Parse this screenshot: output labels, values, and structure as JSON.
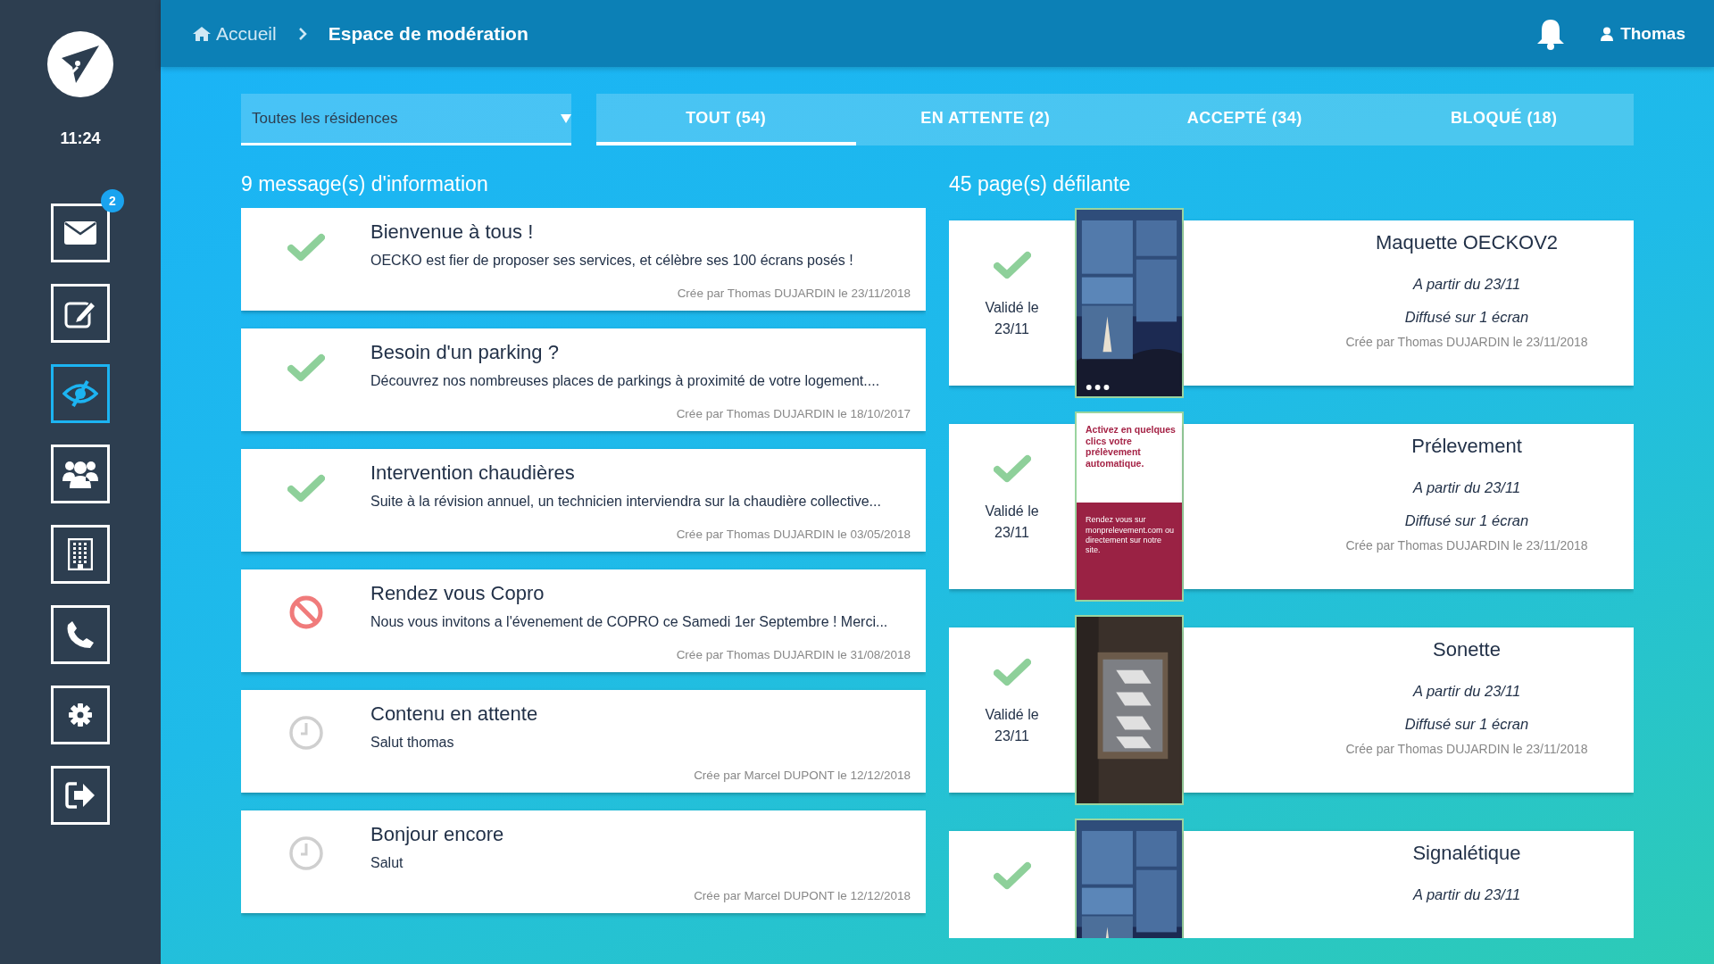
{
  "sidebar": {
    "time": "11:24",
    "items": [
      {
        "kind": "mail",
        "selected": false,
        "badge": "2"
      },
      {
        "kind": "edit",
        "selected": false
      },
      {
        "kind": "moderation",
        "selected": true
      },
      {
        "kind": "users",
        "selected": false
      },
      {
        "kind": "building",
        "selected": false
      },
      {
        "kind": "phone",
        "selected": false
      },
      {
        "kind": "settings",
        "selected": false
      },
      {
        "kind": "logout",
        "selected": false
      }
    ]
  },
  "breadcrumb": [
    {
      "label": "Accueil"
    },
    {
      "label": "Espace de modération"
    }
  ],
  "user": {
    "name": "Thomas"
  },
  "filter": {
    "value": "Toutes les résidences"
  },
  "tabs": [
    {
      "label": "TOUT (54)",
      "selected": true
    },
    {
      "label": "EN ATTENTE (2)",
      "selected": false
    },
    {
      "label": "ACCEPTÉ (34)",
      "selected": false
    },
    {
      "label": "BLOQUÉ (18)",
      "selected": false
    }
  ],
  "messages": {
    "heading": "9 message(s) d'information",
    "items": [
      {
        "kind": "accepted",
        "title": "Bienvenue à tous !",
        "body": "OECKO est fier de proposer ses services, et célèbre ses 100 écrans posés !",
        "meta": "Crée par Thomas DUJARDIN le 23/11/2018"
      },
      {
        "kind": "accepted",
        "title": "Besoin d'un parking ?",
        "body": "Découvrez nos nombreuses places de parkings à proximité de votre logement....",
        "meta": "Crée par Thomas DUJARDIN le 18/10/2017"
      },
      {
        "kind": "accepted",
        "title": "Intervention chaudières",
        "body": "Suite à la révision annuel, un technicien interviendra sur la chaudière collective...",
        "meta": "Crée par Thomas DUJARDIN le 03/05/2018"
      },
      {
        "kind": "blocked",
        "title": "Rendez vous Copro",
        "body": "Nous vous invitons a l'évenement de COPRO ce Samedi 1er Septembre ! Merci...",
        "meta": "Crée par Thomas DUJARDIN le 31/08/2018"
      },
      {
        "kind": "pending",
        "title": "Contenu en attente",
        "body": "Salut thomas",
        "meta": "Crée par Marcel DUPONT le 12/12/2018"
      },
      {
        "kind": "pending",
        "title": "Bonjour encore",
        "body": "Salut",
        "meta": "Crée par Marcel DUPONT le 12/12/2018"
      }
    ]
  },
  "pages": {
    "heading": "45 page(s) défilante",
    "items": [
      {
        "kind": "accepted",
        "validated": "Validé le 23/11",
        "title": "Maquette OECKOV2",
        "start": "A partir du 23/11",
        "screens": "Diffusé sur 1 écran",
        "meta": "Crée par Thomas DUJARDIN le 23/11/2018"
      },
      {
        "kind": "accepted",
        "validated": "Validé le 23/11",
        "thumbnail": {
          "kind": "poster",
          "headline": "Activez en quelques clics votre prélèvement automatique.",
          "text": "Rendez vous sur monprelevement.com ou directement sur notre site."
        },
        "title": "Prélevement",
        "start": "A partir du 23/11",
        "screens": "Diffusé sur 1 écran",
        "meta": "Crée par Thomas DUJARDIN le 23/11/2018"
      },
      {
        "kind": "accepted",
        "validated": "Validé le 23/11",
        "title": "Sonette",
        "start": "A partir du 23/11",
        "screens": "Diffusé sur 1 écran",
        "meta": "Crée par Thomas DUJARDIN le 23/11/2018"
      },
      {
        "kind": "accepted",
        "title": "Signalétique",
        "start": "A partir du 23/11"
      }
    ]
  }
}
